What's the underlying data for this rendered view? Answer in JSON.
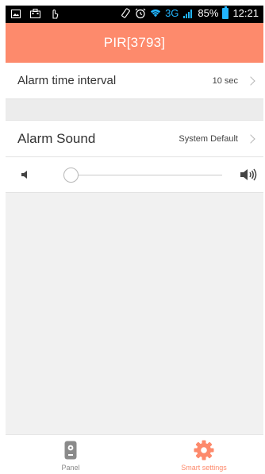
{
  "status_bar": {
    "battery_percent": "85%",
    "time": "12:21",
    "network": "3G",
    "icons": [
      "image-icon",
      "briefcase-icon",
      "touch-icon",
      "rotate-icon",
      "alarm-clock-icon",
      "wifi-icon",
      "signal-icon",
      "battery-icon"
    ]
  },
  "header": {
    "title": "PIR[3793]"
  },
  "settings": {
    "alarm_interval": {
      "label": "Alarm time interval",
      "value": "10 sec"
    },
    "alarm_sound": {
      "label": "Alarm Sound",
      "value": "System Default"
    },
    "volume": {
      "level": 0.05,
      "low_icon": "volume-low-icon",
      "high_icon": "volume-high-icon"
    }
  },
  "tabbar": {
    "tabs": [
      {
        "label": "Panel",
        "icon": "panel-device-icon",
        "active": false
      },
      {
        "label": "Smart settings",
        "icon": "gear-icon",
        "active": true
      }
    ]
  },
  "colors": {
    "accent": "#fd8a6c",
    "status_accent": "#22b5ff",
    "background": "#f1f1f1",
    "row_background": "#ffffff",
    "inactive_tab": "#8a8a8a"
  }
}
